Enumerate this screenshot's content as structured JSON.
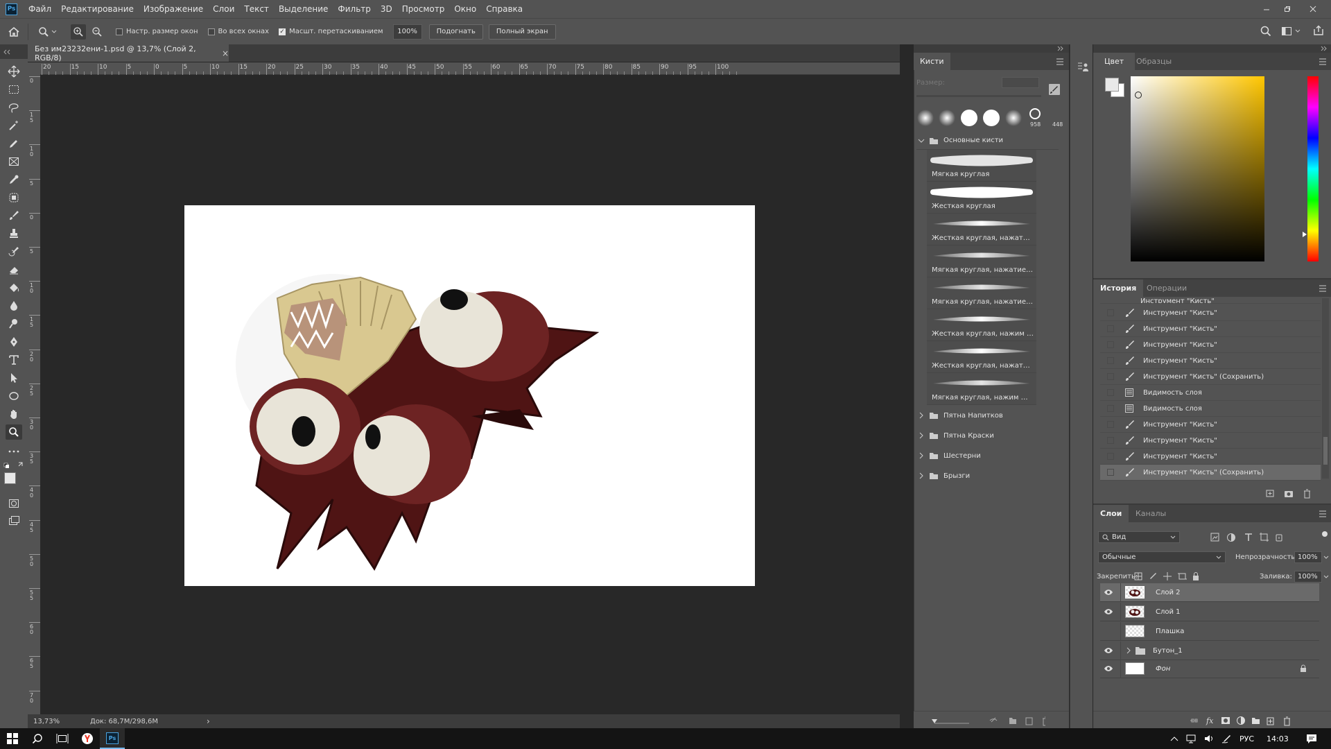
{
  "menubar": {
    "logo": "Ps",
    "items": [
      "Файл",
      "Редактирование",
      "Изображение",
      "Слои",
      "Текст",
      "Выделение",
      "Фильтр",
      "3D",
      "Просмотр",
      "Окно",
      "Справка"
    ]
  },
  "options": {
    "resize_windows": "Настр. размер окон",
    "all_windows": "Во всех окнах",
    "scrubby_zoom": "Масшт. перетаскиванием",
    "zoom_value": "100%",
    "fit_button": "Подогнать",
    "fullscreen_button": "Полный экран",
    "resize_checked": false,
    "all_checked": false,
    "scrubby_checked": true
  },
  "document": {
    "tab_title": "Без им23232ени-1.psd @ 13,7% (Слой 2, RGB/8)",
    "close": "×",
    "ruler_h": [
      "20",
      "15",
      "10",
      "5",
      "0",
      "5",
      "10",
      "15",
      "20",
      "25",
      "30",
      "35",
      "40",
      "45",
      "50",
      "55",
      "60",
      "65",
      "70",
      "75",
      "80",
      "85",
      "90",
      "95",
      "100"
    ],
    "ruler_v": [
      "0",
      "1 5",
      "1 0",
      "5",
      "0",
      "5",
      "1 0",
      "1 5",
      "2 0",
      "2 5",
      "3 0",
      "3 5",
      "4 0",
      "4 5",
      "5 0",
      "5 5",
      "6 0",
      "6 5",
      "7 0"
    ],
    "zoom": "13,73%",
    "doc_size": "Док: 68,7M/298,6M",
    "arrow": "›"
  },
  "brushes": {
    "tab": "Кисти",
    "size_label": "Размер:",
    "preset_sizes": [
      "958",
      "448"
    ],
    "group": "Основные кисти",
    "items": [
      "Мягкая круглая",
      "Жесткая круглая",
      "Жесткая круглая, нажатие =...",
      "Мягкая круглая, нажатие = р...",
      "Мягкая круглая, нажатие = н...",
      "Жесткая круглая, нажим — м...",
      "Жесткая круглая, нажатие =...",
      "Мягкая круглая, нажим — на..."
    ],
    "folders": [
      "Пятна Напитков",
      "Пятна Краски",
      "Шестерни",
      "Брызги"
    ]
  },
  "color": {
    "tabs": [
      "Цвет",
      "Образцы"
    ],
    "hue": "#ffc600",
    "fg": "#e8e8e8",
    "bg": "#ffffff"
  },
  "history": {
    "tabs": [
      "История",
      "Операции"
    ],
    "partial": "Инструмент \"Кисть\"",
    "items": [
      {
        "label": "Инструмент \"Кисть\"",
        "icon": "brush"
      },
      {
        "label": "Инструмент \"Кисть\"",
        "icon": "brush"
      },
      {
        "label": "Инструмент \"Кисть\"",
        "icon": "brush"
      },
      {
        "label": "Инструмент \"Кисть\"",
        "icon": "brush"
      },
      {
        "label": "Инструмент \"Кисть\" (Сохранить)",
        "icon": "brush"
      },
      {
        "label": "Видимость слоя",
        "icon": "doc"
      },
      {
        "label": "Видимость слоя",
        "icon": "doc"
      },
      {
        "label": "Инструмент \"Кисть\"",
        "icon": "brush"
      },
      {
        "label": "Инструмент \"Кисть\"",
        "icon": "brush"
      },
      {
        "label": "Инструмент \"Кисть\"",
        "icon": "brush"
      },
      {
        "label": "Инструмент \"Кисть\" (Сохранить)",
        "icon": "brush"
      }
    ]
  },
  "layers": {
    "tabs": [
      "Слои",
      "Каналы"
    ],
    "filter": "Вид",
    "blend": "Обычные",
    "opacity_label": "Непрозрачность:",
    "opacity": "100%",
    "lock_label": "Закрепить:",
    "fill_label": "Заливка:",
    "fill": "100%",
    "items": [
      {
        "name": "Слой 2",
        "visible": true,
        "selected": true,
        "type": "layer"
      },
      {
        "name": "Слой 1",
        "visible": true,
        "selected": false,
        "type": "layer"
      },
      {
        "name": "Плашка",
        "visible": false,
        "selected": false,
        "type": "layer"
      },
      {
        "name": "Бутон_1",
        "visible": true,
        "selected": false,
        "type": "group"
      },
      {
        "name": "Фон",
        "visible": true,
        "selected": false,
        "type": "background"
      }
    ]
  },
  "taskbar": {
    "lang": "РУС",
    "time": "14:03"
  }
}
